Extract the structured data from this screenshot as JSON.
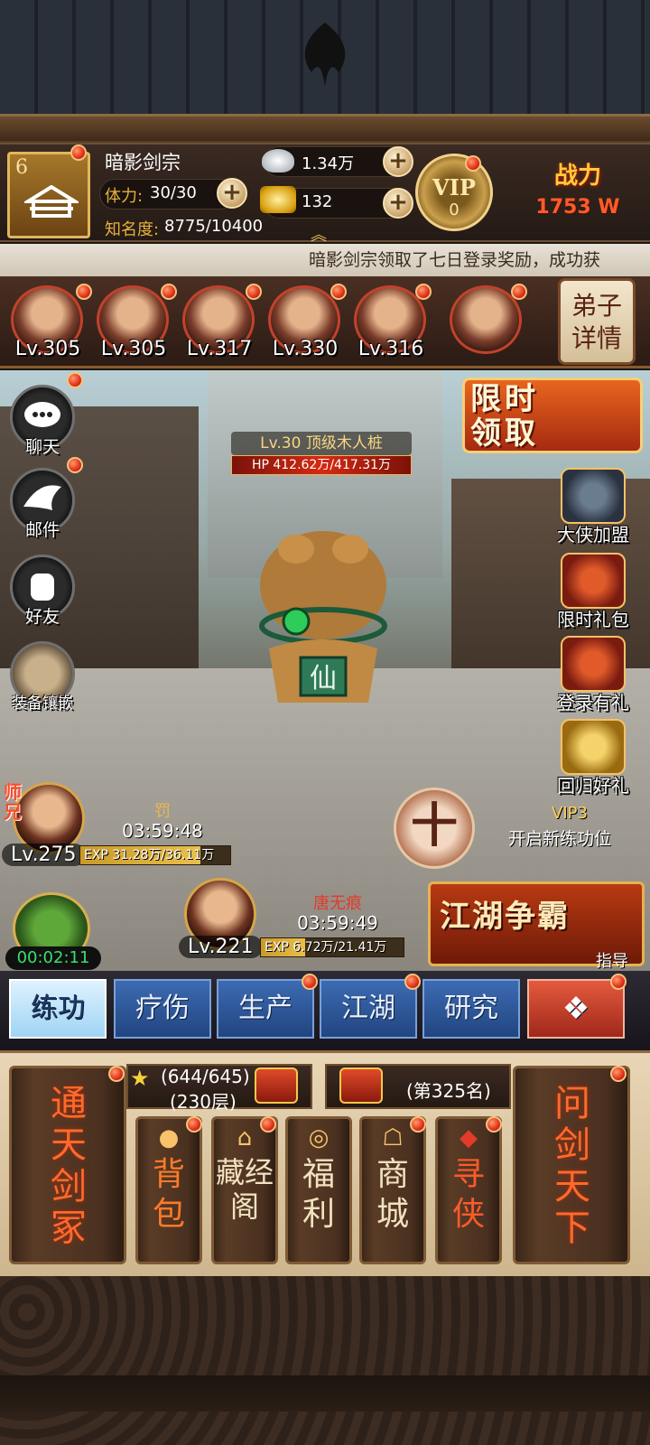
{
  "player": {
    "level": "6",
    "name": "暗影剑宗",
    "stamina_label": "体力:",
    "stamina_value": "30/30",
    "fame_label": "知名度:",
    "fame_value": "8775/10400",
    "silver": "1.34万",
    "gold": "132",
    "vip_label": "VIP",
    "vip_level": "0",
    "power_label": "战力",
    "power_value": "1753 W"
  },
  "ticker": "暗影剑宗领取了七日登录奖励，成功获",
  "disciples": [
    {
      "level": "Lv.305"
    },
    {
      "level": "Lv.305"
    },
    {
      "level": "Lv.317"
    },
    {
      "level": "Lv.330"
    },
    {
      "level": "Lv.316"
    }
  ],
  "disciple_detail_btn": "弟子详情",
  "left_menu": [
    {
      "label": "聊天",
      "icon": "chat-icon"
    },
    {
      "label": "邮件",
      "icon": "mail-dove-icon"
    },
    {
      "label": "好友",
      "icon": "friends-fist-icon"
    },
    {
      "label": "装备镶嵌",
      "icon": "gem-inlay-icon"
    }
  ],
  "right_menu": [
    {
      "label": "大侠加盟",
      "icon": "hero-join-icon"
    },
    {
      "label": "限时礼包",
      "icon": "limited-gift-icon"
    },
    {
      "label": "登录有礼",
      "icon": "login-gift-icon"
    },
    {
      "label": "回归好礼",
      "icon": "return-gift-icon"
    }
  ],
  "limited_claim": "限时领取",
  "target": {
    "title": "Lv.30 顶级木人桩",
    "hp": "HP 412.62万/417.31万",
    "seal_char": "仙"
  },
  "training": [
    {
      "badge": "师兄",
      "name": "罚",
      "time": "03:59:48",
      "level": "Lv.275",
      "exp": "EXP 31.28万/36.11万",
      "exp_fraction": 0.866
    },
    {
      "name": "唐无痕",
      "time": "03:59:49",
      "level": "Lv.221",
      "exp": "EXP 6.72万/21.41万",
      "exp_fraction": 0.314
    }
  ],
  "add_slot_symbol": "十",
  "vip3_label": "VIP3",
  "vip3_desc": "开启新练功位",
  "jianghu_event": "江湖争霸",
  "guide_label": "指导",
  "building_timer": "00:02:11",
  "tabs": [
    {
      "label": "练功",
      "active": true
    },
    {
      "label": "疗伤"
    },
    {
      "label": "生产"
    },
    {
      "label": "江湖"
    },
    {
      "label": "研究"
    },
    {
      "label": "❖"
    }
  ],
  "bottom": {
    "left_scroll": "通天剑冢",
    "right_scroll": "问剑天下",
    "tower_progress": "(644/645)",
    "tower_floor": "(230层)",
    "rank": "(第325名)",
    "items": [
      {
        "label": "背包",
        "icon": "bag-icon"
      },
      {
        "label": "藏经阁",
        "icon": "pavilion-icon"
      },
      {
        "label": "福利",
        "icon": "coin-icon"
      },
      {
        "label": "商城",
        "icon": "shop-icon"
      },
      {
        "label": "寻侠",
        "icon": "seek-hero-icon"
      }
    ]
  }
}
